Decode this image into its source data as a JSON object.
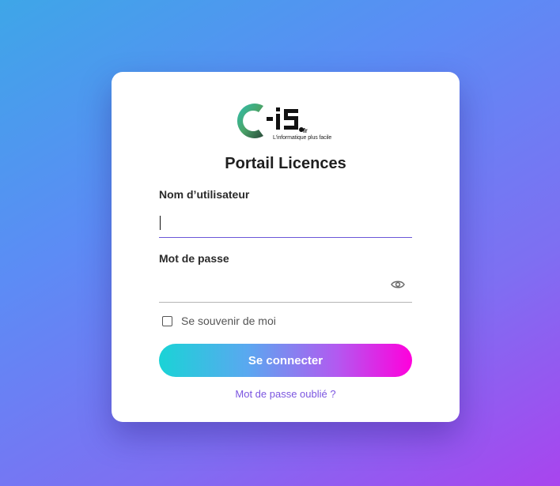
{
  "logo": {
    "brand": "C-is",
    "suffix": "fr",
    "tagline": "L'informatique plus facile"
  },
  "title": "Portail Licences",
  "username": {
    "label": "Nom d’utilisateur",
    "value": "",
    "placeholder": ""
  },
  "password": {
    "label": "Mot de passe",
    "value": "",
    "placeholder": "",
    "toggle_icon": "eye-icon"
  },
  "remember": {
    "label": "Se souvenir de moi",
    "checked": false
  },
  "submit_label": "Se connecter",
  "forgot_label": "Mot de passe oublié ?",
  "colors": {
    "accent": "#7b55e0",
    "button_start": "#1ad3d6",
    "button_end": "#ff00dc",
    "focus_underline": "#6b56d8"
  }
}
